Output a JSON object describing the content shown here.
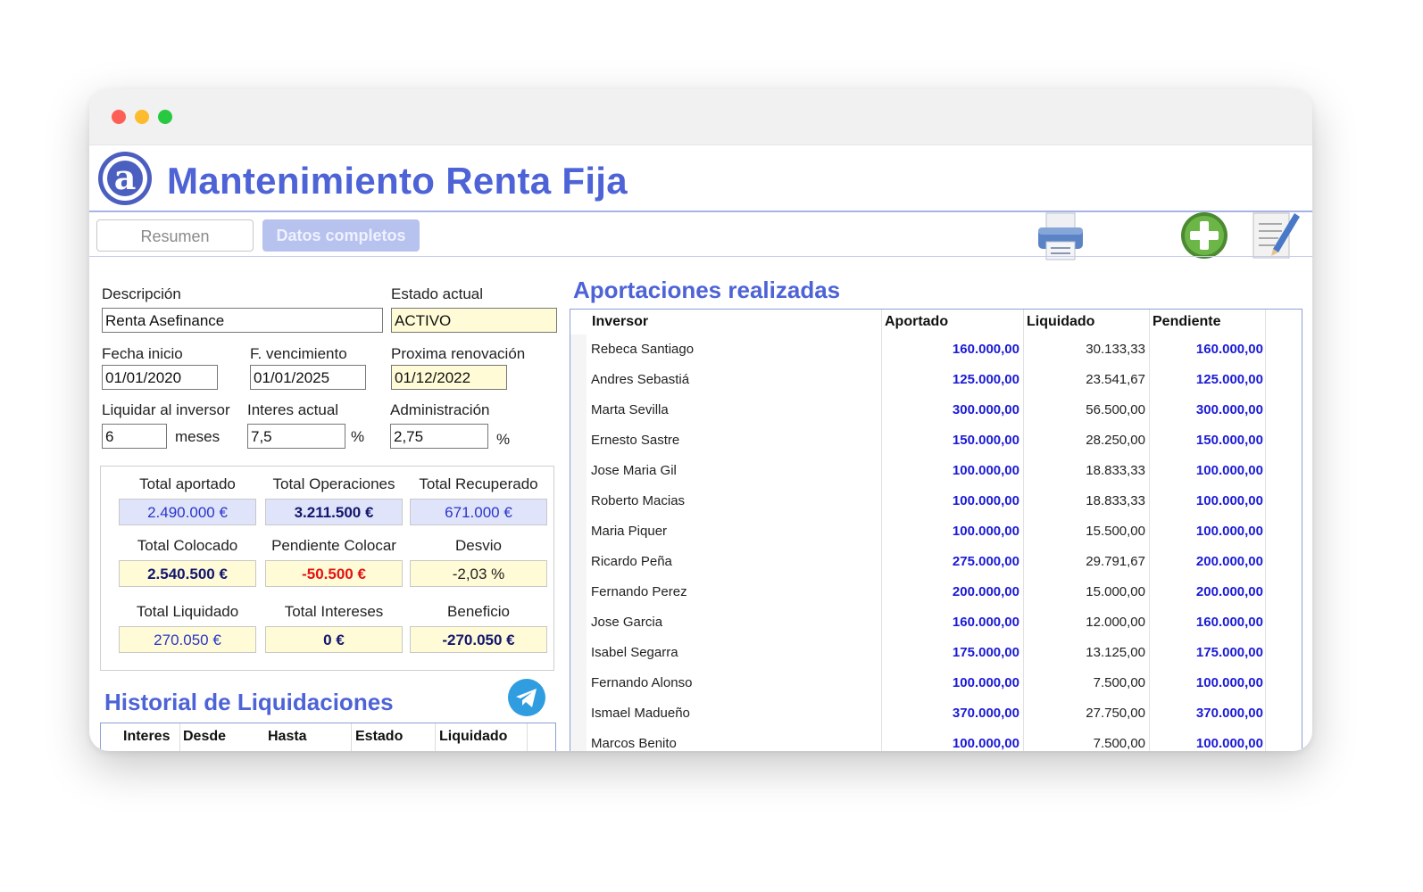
{
  "app": {
    "title": "Mantenimiento Renta Fija"
  },
  "tabs": {
    "resumen": "Resumen",
    "completos": "Datos completos"
  },
  "form": {
    "descripcion_label": "Descripción",
    "descripcion_value": "Renta Asefinance",
    "estado_label": "Estado actual",
    "estado_value": "ACTIVO",
    "fecha_inicio_label": "Fecha inicio",
    "fecha_inicio_value": "01/01/2020",
    "vencimiento_label": "F. vencimiento",
    "vencimiento_value": "01/01/2025",
    "renovacion_label": "Proxima renovación",
    "renovacion_value": "01/12/2022",
    "liquidar_label": "Liquidar al inversor",
    "liquidar_value": "6",
    "liquidar_unit": "meses",
    "interes_label": "Interes actual",
    "interes_value": "7,5",
    "interes_unit": "%",
    "admin_label": "Administración",
    "admin_value": "2,75",
    "admin_unit": "%"
  },
  "summary": {
    "total_aportado_label": "Total aportado",
    "total_aportado_value": "2.490.000 €",
    "total_operaciones_label": "Total Operaciones",
    "total_operaciones_value": "3.211.500 €",
    "total_recuperado_label": "Total Recuperado",
    "total_recuperado_value": "671.000 €",
    "total_colocado_label": "Total Colocado",
    "total_colocado_value": "2.540.500 €",
    "pendiente_colocar_label": "Pendiente Colocar",
    "pendiente_colocar_value": "-50.500 €",
    "desvio_label": "Desvio",
    "desvio_value": "-2,03 %",
    "total_liquidado_label": "Total Liquidado",
    "total_liquidado_value": "270.050 €",
    "total_intereses_label": "Total Intereses",
    "total_intereses_value": "0 €",
    "beneficio_label": "Beneficio",
    "beneficio_value": "-270.050 €"
  },
  "historial": {
    "title": "Historial de Liquidaciones",
    "columns": [
      "Interes",
      "Desde",
      "Hasta",
      "Estado",
      "Liquidado"
    ]
  },
  "aportaciones": {
    "title": "Aportaciones realizadas",
    "columns": [
      "Inversor",
      "Aportado",
      "Liquidado",
      "Pendiente"
    ],
    "rows": [
      [
        "Rebeca Santiago",
        "160.000,00",
        "30.133,33",
        "160.000,00"
      ],
      [
        "Andres Sebastiá",
        "125.000,00",
        "23.541,67",
        "125.000,00"
      ],
      [
        "Marta Sevilla",
        "300.000,00",
        "56.500,00",
        "300.000,00"
      ],
      [
        "Ernesto Sastre",
        "150.000,00",
        "28.250,00",
        "150.000,00"
      ],
      [
        "Jose Maria Gil",
        "100.000,00",
        "18.833,33",
        "100.000,00"
      ],
      [
        "Roberto Macias",
        "100.000,00",
        "18.833,33",
        "100.000,00"
      ],
      [
        "Maria Piquer",
        "100.000,00",
        "15.500,00",
        "100.000,00"
      ],
      [
        "Ricardo Peña",
        "275.000,00",
        "29.791,67",
        "200.000,00"
      ],
      [
        "Fernando Perez",
        "200.000,00",
        "15.000,00",
        "200.000,00"
      ],
      [
        "Jose Garcia",
        "160.000,00",
        "12.000,00",
        "160.000,00"
      ],
      [
        "Isabel Segarra",
        "175.000,00",
        "13.125,00",
        "175.000,00"
      ],
      [
        "Fernando Alonso",
        "100.000,00",
        "7.500,00",
        "100.000,00"
      ],
      [
        "Ismael Madueño",
        "370.000,00",
        "27.750,00",
        "370.000,00"
      ],
      [
        "Marcos Benito",
        "100.000,00",
        "7.500,00",
        "100.000,00"
      ]
    ]
  },
  "icons": {
    "logo": "app-logo-icon",
    "print": "printer-icon",
    "add": "add-plus-icon",
    "edit": "edit-document-icon",
    "send": "telegram-send-icon"
  },
  "colors": {
    "accent": "#4d63d6",
    "value_blue": "#1a1ad6",
    "value_red": "#e51212",
    "field_yellow": "#fffbd6",
    "field_blue": "#dfe4fb"
  }
}
